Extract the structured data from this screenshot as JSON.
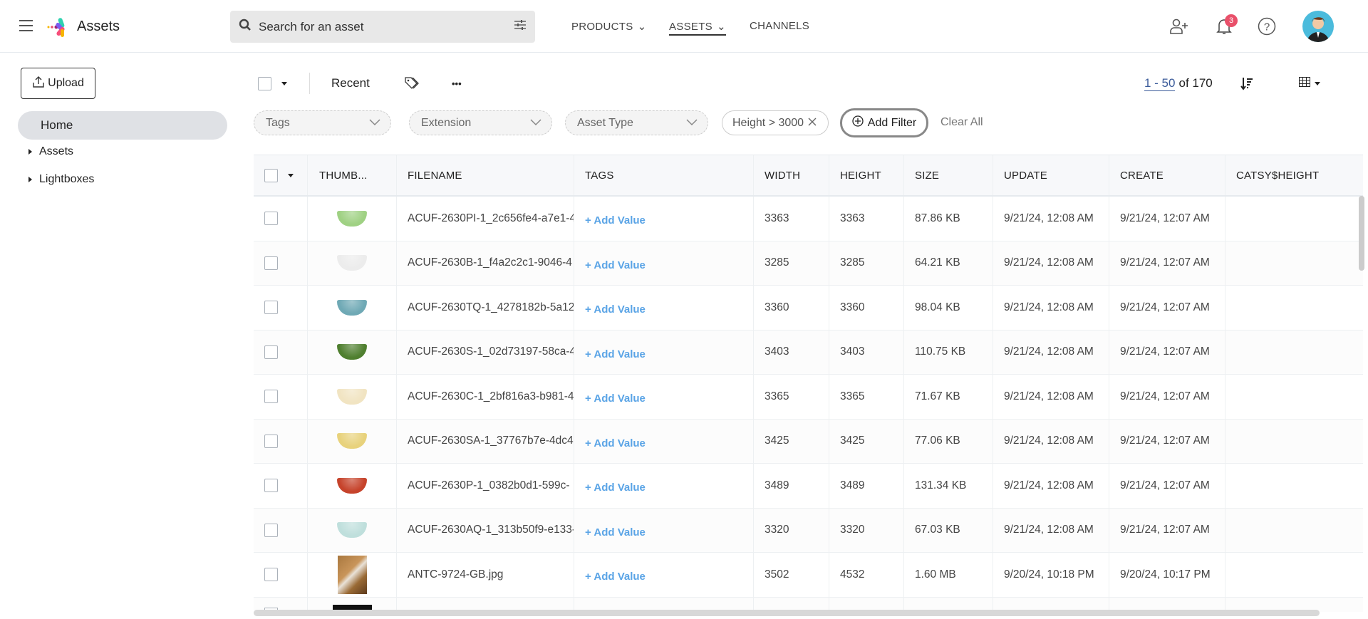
{
  "header": {
    "app_title": "Assets",
    "search_placeholder": "Search for an asset",
    "nav": [
      {
        "label": "PRODUCTS"
      },
      {
        "label": "ASSETS"
      },
      {
        "label": "CHANNELS"
      }
    ],
    "notification_count": "3"
  },
  "sidebar": {
    "upload_label": "Upload",
    "home_label": "Home",
    "tree": [
      {
        "label": "Assets"
      },
      {
        "label": "Lightboxes"
      }
    ]
  },
  "toolbar": {
    "recent_label": "Recent",
    "more_label": "•••",
    "pagination_range": "1 - 50",
    "pagination_total": "of 170"
  },
  "filters": {
    "items": [
      {
        "label": "Tags"
      },
      {
        "label": "Extension"
      },
      {
        "label": "Asset Type"
      }
    ],
    "active_chip": "Height > 3000",
    "add_filter": "Add Filter",
    "clear_all": "Clear All"
  },
  "table": {
    "columns": [
      "THUMB...",
      "FILENAME",
      "TAGS",
      "WIDTH",
      "HEIGHT",
      "SIZE",
      "UPDATE",
      "CREATE",
      "CATSY$HEIGHT"
    ],
    "add_value_label": "+ Add Value",
    "rows": [
      {
        "thumb_color": "#9fd183",
        "filename": "ACUF-2630PI-1_2c656fe4-a7e1-4",
        "width": "3363",
        "height": "3363",
        "size": "87.86 KB",
        "update": "9/21/24, 12:08 AM",
        "create": "9/21/24, 12:07 AM"
      },
      {
        "thumb_color": "#ececec",
        "filename": "ACUF-2630B-1_f4a2c2c1-9046-4",
        "width": "3285",
        "height": "3285",
        "size": "64.21 KB",
        "update": "9/21/24, 12:08 AM",
        "create": "9/21/24, 12:07 AM"
      },
      {
        "thumb_color": "#6fa9b5",
        "filename": "ACUF-2630TQ-1_4278182b-5a12",
        "width": "3360",
        "height": "3360",
        "size": "98.04 KB",
        "update": "9/21/24, 12:08 AM",
        "create": "9/21/24, 12:07 AM"
      },
      {
        "thumb_color": "#4f7f2f",
        "filename": "ACUF-2630S-1_02d73197-58ca-4",
        "width": "3403",
        "height": "3403",
        "size": "110.75 KB",
        "update": "9/21/24, 12:08 AM",
        "create": "9/21/24, 12:07 AM"
      },
      {
        "thumb_color": "#f1e4c2",
        "filename": "ACUF-2630C-1_2bf816a3-b981-4",
        "width": "3365",
        "height": "3365",
        "size": "71.67 KB",
        "update": "9/21/24, 12:08 AM",
        "create": "9/21/24, 12:07 AM"
      },
      {
        "thumb_color": "#e8d27c",
        "filename": "ACUF-2630SA-1_37767b7e-4dc4",
        "width": "3425",
        "height": "3425",
        "size": "77.06 KB",
        "update": "9/21/24, 12:08 AM",
        "create": "9/21/24, 12:07 AM"
      },
      {
        "thumb_color": "#c6432b",
        "filename": "ACUF-2630P-1_0382b0d1-599c-",
        "width": "3489",
        "height": "3489",
        "size": "131.34 KB",
        "update": "9/21/24, 12:08 AM",
        "create": "9/21/24, 12:07 AM"
      },
      {
        "thumb_color": "#bfdfdc",
        "filename": "ACUF-2630AQ-1_313b50f9-e133-",
        "width": "3320",
        "height": "3320",
        "size": "67.03 KB",
        "update": "9/21/24, 12:08 AM",
        "create": "9/21/24, 12:07 AM"
      },
      {
        "thumb_color": "photo",
        "filename": "ANTC-9724-GB.jpg",
        "width": "3502",
        "height": "4532",
        "size": "1.60 MB",
        "update": "9/20/24, 10:18 PM",
        "create": "9/20/24, 10:17 PM"
      }
    ]
  }
}
